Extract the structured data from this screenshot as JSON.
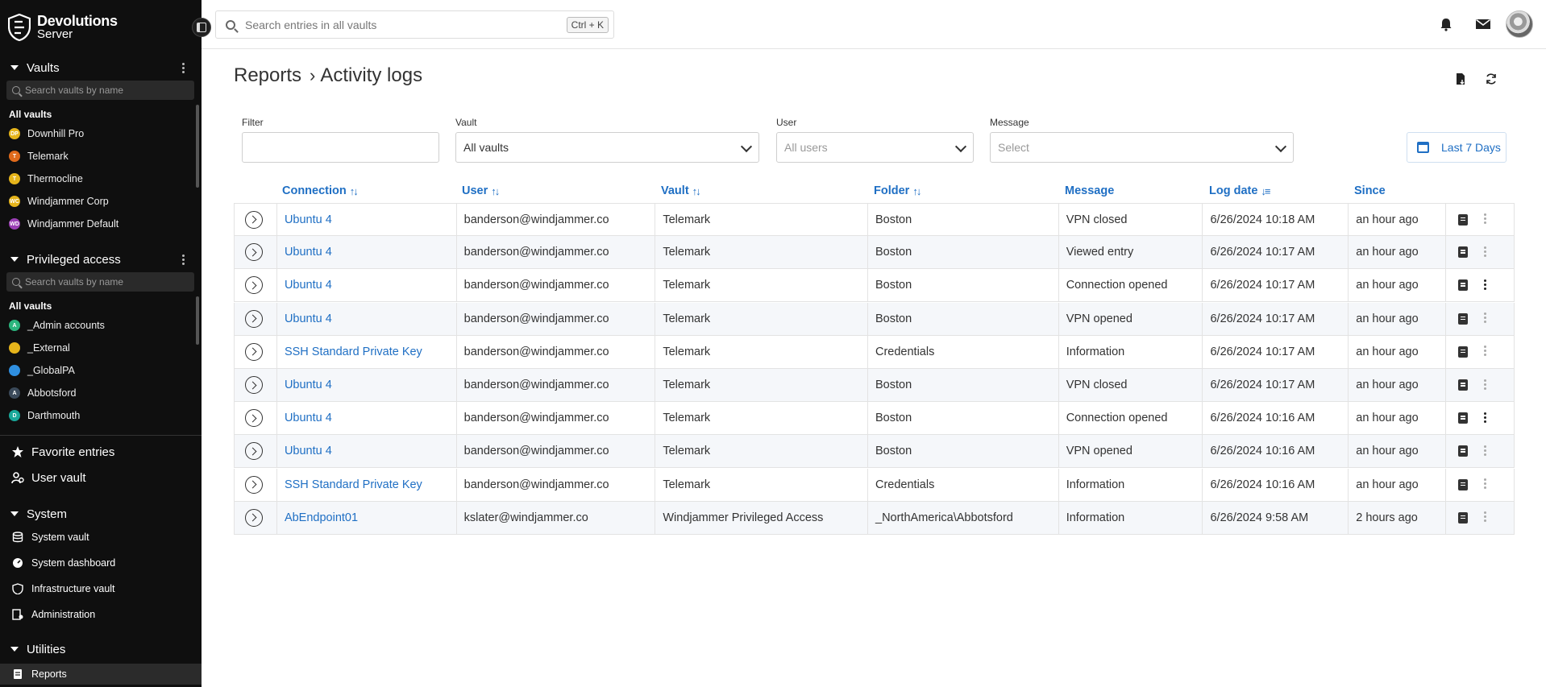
{
  "sidebar": {
    "logo": {
      "line1": "Devolutions",
      "line2": "Server"
    },
    "vaults": {
      "title": "Vaults",
      "search_placeholder": "Search vaults by name",
      "all_label": "All vaults",
      "items": [
        {
          "label": "Downhill Pro",
          "initials": "DP",
          "color": "#e5b41b"
        },
        {
          "label": "Telemark",
          "initials": "T",
          "color": "#e06a1b"
        },
        {
          "label": "Thermocline",
          "initials": "T",
          "color": "#e5b41b"
        },
        {
          "label": "Windjammer Corp",
          "initials": "WC",
          "color": "#e5b41b"
        },
        {
          "label": "Windjammer Default",
          "initials": "WD",
          "color": "#9b3fb5"
        }
      ]
    },
    "privileged": {
      "title": "Privileged access",
      "search_placeholder": "Search vaults by name",
      "all_label": "All vaults",
      "items": [
        {
          "label": "_Admin accounts",
          "initials": "A",
          "color": "#2bb57d"
        },
        {
          "label": "_External",
          "initials": "",
          "color": "#e5b41b"
        },
        {
          "label": "_GlobalPA",
          "initials": "",
          "color": "#2f8fe0"
        },
        {
          "label": "Abbotsford",
          "initials": "A",
          "color": "#3b4a5a"
        },
        {
          "label": "Darthmouth",
          "initials": "D",
          "color": "#19a89a"
        }
      ]
    },
    "favorites": "Favorite entries",
    "user_vault": "User vault",
    "system": {
      "title": "System",
      "items": [
        "System vault",
        "System dashboard",
        "Infrastructure vault",
        "Administration"
      ]
    },
    "utilities": {
      "title": "Utilities",
      "items": [
        "Reports"
      ]
    }
  },
  "topbar": {
    "search_placeholder": "Search entries in all vaults",
    "shortcut": "Ctrl + K"
  },
  "page": {
    "breadcrumb_root": "Reports",
    "breadcrumb_current": "Activity logs"
  },
  "filters": {
    "filter_label": "Filter",
    "filter_value": "",
    "vault_label": "Vault",
    "vault_value": "All vaults",
    "user_label": "User",
    "user_placeholder": "All users",
    "message_label": "Message",
    "message_placeholder": "Select",
    "date_range": "Last 7 Days"
  },
  "table": {
    "columns": [
      "Connection",
      "User",
      "Vault",
      "Folder",
      "Message",
      "Log date",
      "Since"
    ],
    "rows": [
      {
        "connection": "Ubuntu 4",
        "user": "banderson@windjammer.co",
        "vault": "Telemark",
        "folder": "Boston",
        "message": "VPN closed",
        "log_date": "6/26/2024 10:18 AM",
        "since": "an hour ago"
      },
      {
        "connection": "Ubuntu 4",
        "user": "banderson@windjammer.co",
        "vault": "Telemark",
        "folder": "Boston",
        "message": "Viewed entry",
        "log_date": "6/26/2024 10:17 AM",
        "since": "an hour ago"
      },
      {
        "connection": "Ubuntu 4",
        "user": "banderson@windjammer.co",
        "vault": "Telemark",
        "folder": "Boston",
        "message": "Connection opened",
        "log_date": "6/26/2024 10:17 AM",
        "since": "an hour ago"
      },
      {
        "connection": "Ubuntu 4",
        "user": "banderson@windjammer.co",
        "vault": "Telemark",
        "folder": "Boston",
        "message": "VPN opened",
        "log_date": "6/26/2024 10:17 AM",
        "since": "an hour ago"
      },
      {
        "connection": "SSH Standard Private Key",
        "user": "banderson@windjammer.co",
        "vault": "Telemark",
        "folder": "Credentials",
        "message": "Information",
        "log_date": "6/26/2024 10:17 AM",
        "since": "an hour ago"
      },
      {
        "connection": "Ubuntu 4",
        "user": "banderson@windjammer.co",
        "vault": "Telemark",
        "folder": "Boston",
        "message": "VPN closed",
        "log_date": "6/26/2024 10:17 AM",
        "since": "an hour ago"
      },
      {
        "connection": "Ubuntu 4",
        "user": "banderson@windjammer.co",
        "vault": "Telemark",
        "folder": "Boston",
        "message": "Connection opened",
        "log_date": "6/26/2024 10:16 AM",
        "since": "an hour ago"
      },
      {
        "connection": "Ubuntu 4",
        "user": "banderson@windjammer.co",
        "vault": "Telemark",
        "folder": "Boston",
        "message": "VPN opened",
        "log_date": "6/26/2024 10:16 AM",
        "since": "an hour ago"
      },
      {
        "connection": "SSH Standard Private Key",
        "user": "banderson@windjammer.co",
        "vault": "Telemark",
        "folder": "Credentials",
        "message": "Information",
        "log_date": "6/26/2024 10:16 AM",
        "since": "an hour ago"
      },
      {
        "connection": "AbEndpoint01",
        "user": "kslater@windjammer.co",
        "vault": "Windjammer Privileged Access",
        "folder": "_NorthAmerica\\Abbotsford",
        "message": "Information",
        "log_date": "6/26/2024 9:58 AM",
        "since": "2 hours ago"
      }
    ]
  },
  "colors": {
    "accent": "#1f6fc4",
    "sidebar_bg": "#0f0f0f"
  }
}
